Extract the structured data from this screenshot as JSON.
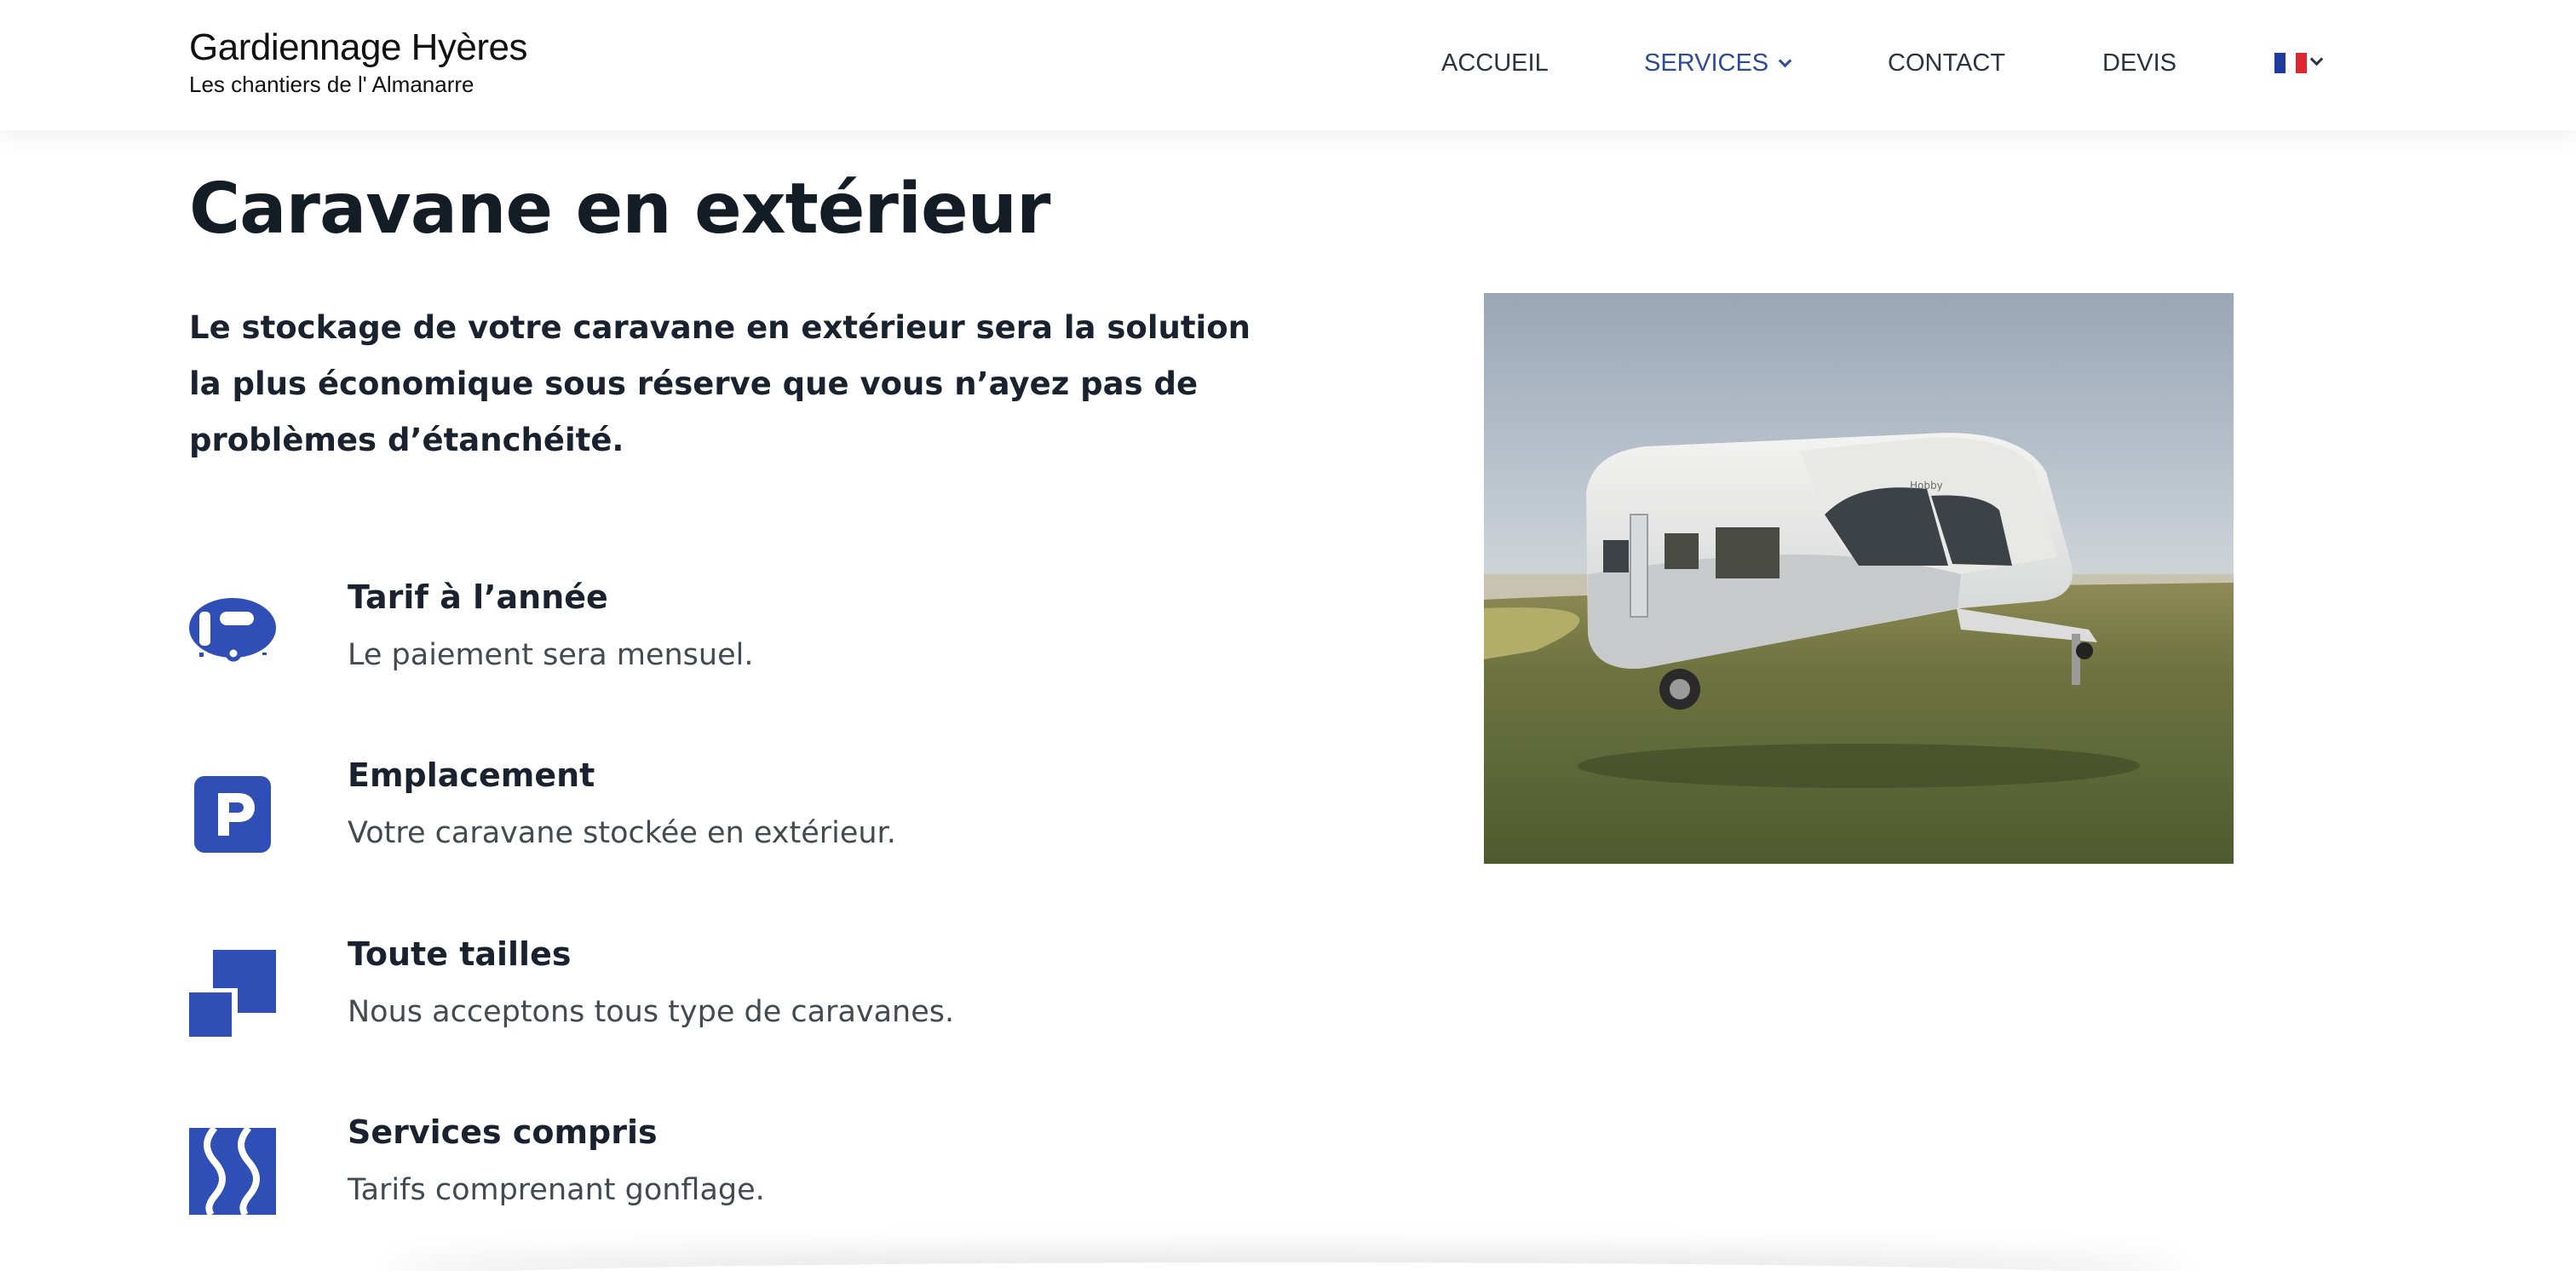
{
  "brand": {
    "title": "Gardiennage Hyères",
    "subtitle": "Les chantiers de l' Almanarre"
  },
  "nav": {
    "items": [
      {
        "label": "ACCUEIL"
      },
      {
        "label": "SERVICES"
      },
      {
        "label": "CONTACT"
      },
      {
        "label": "DEVIS"
      }
    ],
    "active": "SERVICES",
    "language_icon": "france-flag-icon"
  },
  "page": {
    "title": "Caravane en extérieur",
    "intro": "Le stockage de votre caravane en extérieur sera la solution la plus économique sous réserve que vous n’ayez pas de problèmes d’étanchéité."
  },
  "features": [
    {
      "icon": "caravan-icon",
      "title": "Tarif à l’année",
      "description": "Le paiement sera mensuel."
    },
    {
      "icon": "parking-icon",
      "title": "Emplacement",
      "description": "Votre caravane stockée en extérieur."
    },
    {
      "icon": "overlapping-squares-icon",
      "title": "Toute tailles",
      "description": "Nous acceptons tous type de caravanes."
    },
    {
      "icon": "waves-icon",
      "title": "Services compris",
      "description": "Tarifs comprenant gonflage."
    }
  ],
  "image": {
    "icon": "caravan-photo",
    "brand_text": "Hobby"
  },
  "colors": {
    "accent": "#2c4a9c",
    "icon_blue": "#2f4fb6",
    "heading": "#141c26",
    "text": "#444a52"
  }
}
